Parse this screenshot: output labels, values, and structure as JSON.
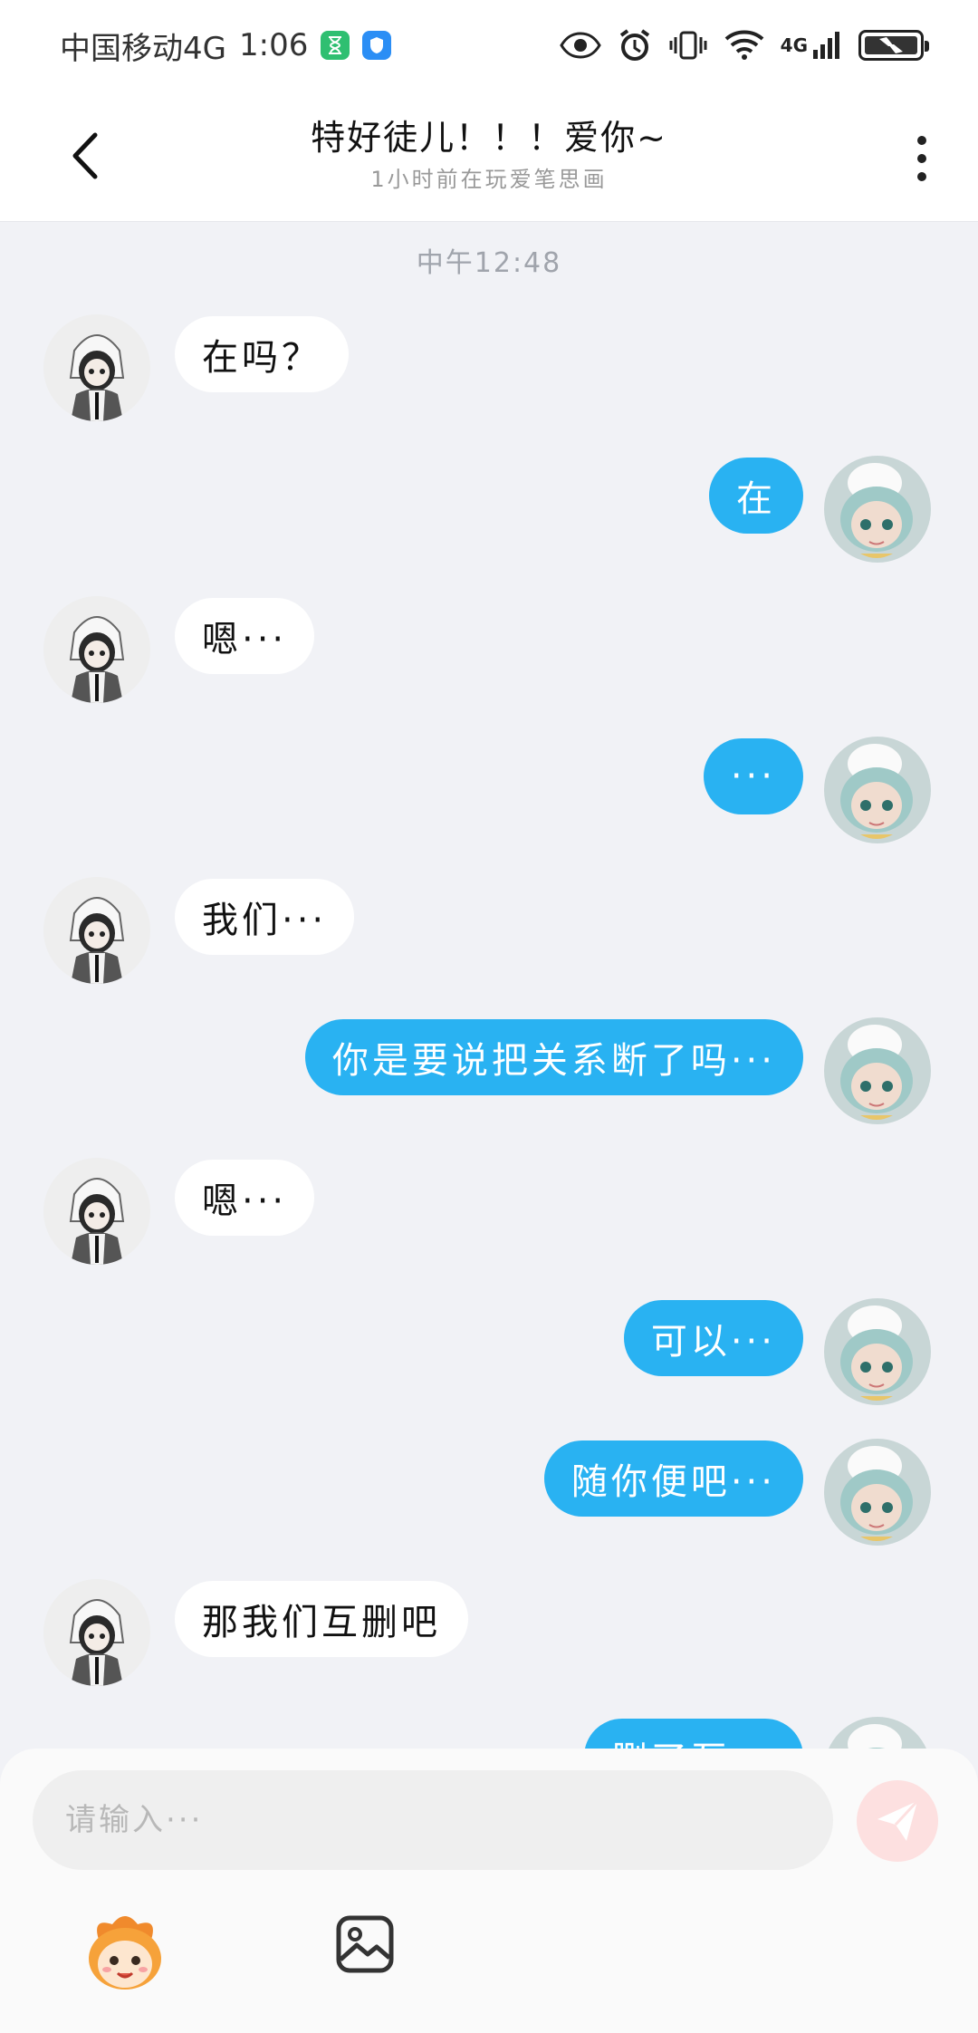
{
  "status_bar": {
    "carrier": "中国移动4G",
    "time": "1:06",
    "network": "4G"
  },
  "header": {
    "title": "特好徒儿！！！爱你~",
    "subtitle": "1小时前在玩爱笔思画"
  },
  "chat": {
    "timestamp": "中午12:48",
    "messages": [
      {
        "side": "left",
        "text": "在吗？"
      },
      {
        "side": "right",
        "text": "在"
      },
      {
        "side": "left",
        "text": "嗯···"
      },
      {
        "side": "right",
        "text": "···"
      },
      {
        "side": "left",
        "text": "我们···"
      },
      {
        "side": "right",
        "text": "你是要说把关系断了吗···"
      },
      {
        "side": "left",
        "text": "嗯···"
      },
      {
        "side": "right",
        "text": "可以···"
      },
      {
        "side": "right",
        "text": "随你便吧···"
      },
      {
        "side": "left",
        "text": "那我们互删吧"
      },
      {
        "side": "right",
        "text": "删了互..."
      }
    ]
  },
  "input": {
    "placeholder": "请输入···"
  },
  "colors": {
    "accent": "#29b2f2",
    "background": "#f1f2f6",
    "send_button": "#fde0e0"
  },
  "icons": {
    "back": "chevron-left-icon",
    "more": "more-vertical-icon",
    "send": "send-icon",
    "mascot": "mascot-icon",
    "image": "image-icon"
  }
}
